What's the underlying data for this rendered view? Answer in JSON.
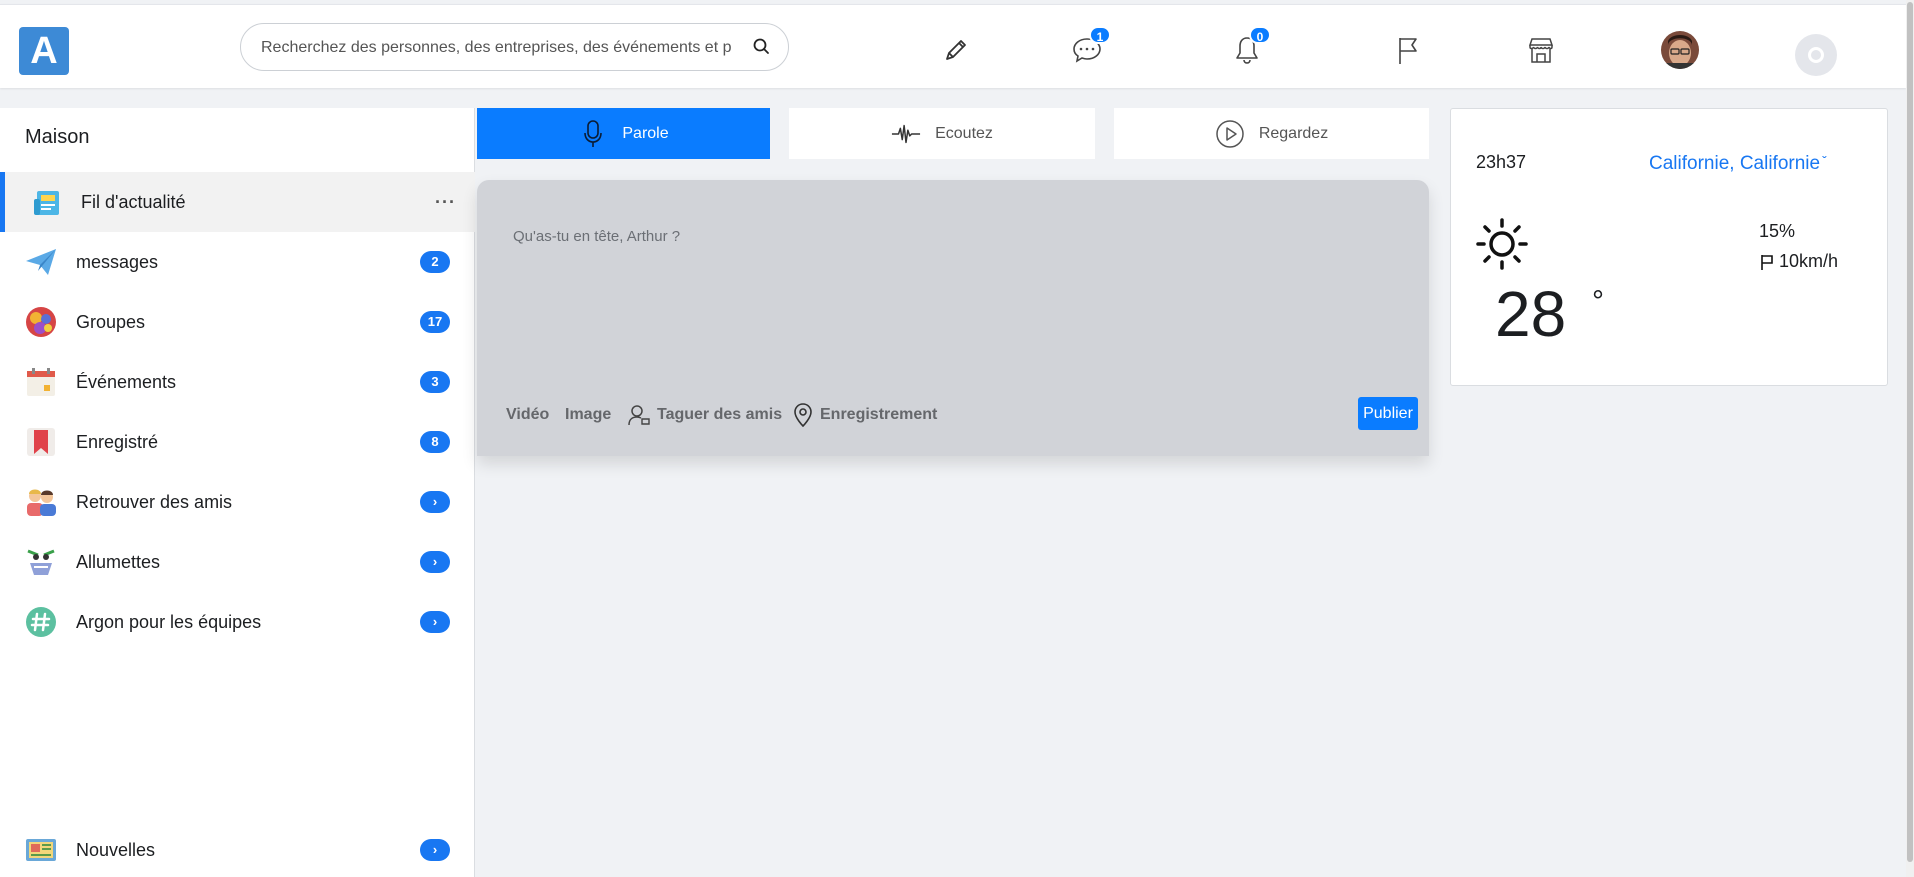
{
  "header": {
    "logo_letter": "A",
    "search_placeholder": "Recherchez des personnes, des entreprises, des événements et pl",
    "messages_badge": "1",
    "notifications_badge": "0"
  },
  "sidebar": {
    "title": "Maison",
    "items": [
      {
        "label": "Fil d'actualité",
        "count": "···",
        "icon": "news-feed-icon"
      },
      {
        "label": "messages",
        "count": "2",
        "icon": "paper-plane-icon"
      },
      {
        "label": "Groupes",
        "count": "17",
        "icon": "groups-icon"
      },
      {
        "label": "Événements",
        "count": "3",
        "icon": "calendar-icon"
      },
      {
        "label": "Enregistré",
        "count": "8",
        "icon": "bookmark-icon"
      },
      {
        "label": "Retrouver des amis",
        "count": "›",
        "icon": "friends-icon"
      },
      {
        "label": "Allumettes",
        "count": "›",
        "icon": "matches-icon"
      },
      {
        "label": "Argon pour les équipes",
        "count": "›",
        "icon": "hashtag-icon"
      },
      {
        "label": "Nouvelles",
        "count": "›",
        "icon": "newspaper-icon"
      }
    ]
  },
  "tabs": [
    {
      "label": "Parole",
      "icon": "microphone-icon",
      "active": true
    },
    {
      "label": "Ecoutez",
      "icon": "waveform-icon",
      "active": false
    },
    {
      "label": "Regardez",
      "icon": "play-icon",
      "active": false
    }
  ],
  "composer": {
    "placeholder": "Qu'as-tu en tête, Arthur ?",
    "actions": {
      "video": "Vidéo",
      "image": "Image",
      "tag": "Taguer des amis",
      "checkin": "Enregistrement"
    },
    "publish_label": "Publier"
  },
  "weather": {
    "time": "23h37",
    "location": "Californie, Californie",
    "temperature": "28",
    "degree_symbol": "°",
    "humidity": "15%",
    "wind": "10km/h",
    "icon": "sun-icon"
  },
  "colors": {
    "accent": "#0a7cff",
    "logo": "#3d8ad6",
    "composer_bg": "#d1d3d8",
    "page_bg": "#f0f2f5"
  }
}
